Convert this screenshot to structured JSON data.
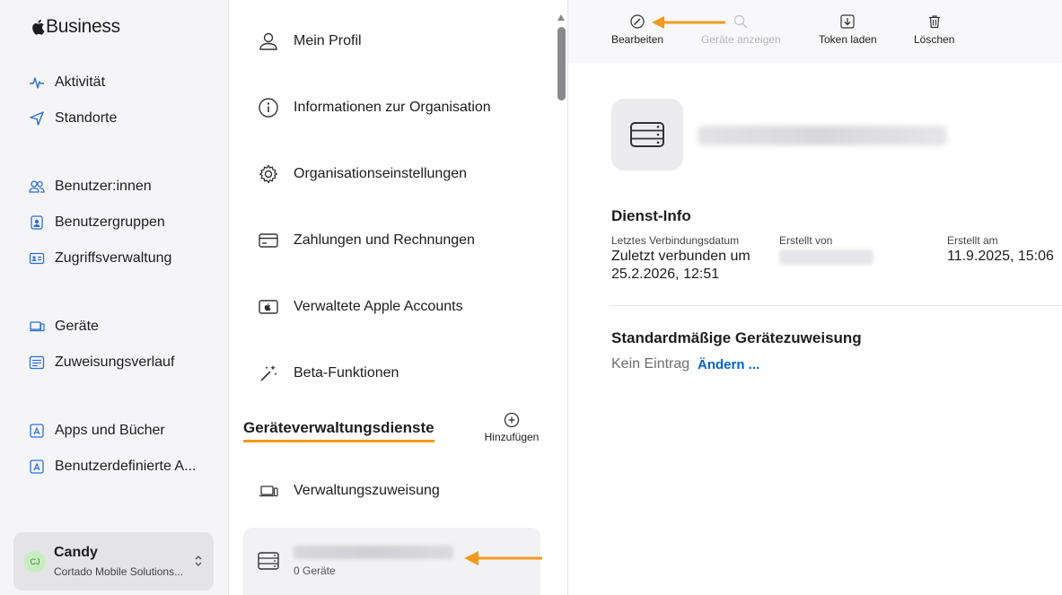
{
  "brand": {
    "name": "Business"
  },
  "sidebar": {
    "items": [
      {
        "label": "Aktivität",
        "icon": "activity-icon"
      },
      {
        "label": "Standorte",
        "icon": "location-arrow-icon"
      },
      {
        "label": "Benutzer:innen",
        "icon": "users-icon"
      },
      {
        "label": "Benutzergruppen",
        "icon": "user-group-badge-icon"
      },
      {
        "label": "Zugriffsverwaltung",
        "icon": "id-card-icon"
      },
      {
        "label": "Geräte",
        "icon": "laptop-icon"
      },
      {
        "label": "Zuweisungsverlauf",
        "icon": "list-history-icon"
      },
      {
        "label": "Apps und Bücher",
        "icon": "app-store-icon"
      },
      {
        "label": "Benutzerdefinierte A...",
        "icon": "app-store-icon"
      }
    ],
    "user": {
      "initials": "CJ",
      "name": "Candy",
      "org": "Cortado Mobile Solutions..."
    }
  },
  "settings": {
    "items": [
      {
        "label": "Mein Profil",
        "icon": "person-icon"
      },
      {
        "label": "Informationen zur Organisation",
        "icon": "info-circle-icon"
      },
      {
        "label": "Organisationseinstellungen",
        "icon": "gear-icon"
      },
      {
        "label": "Zahlungen und Rechnungen",
        "icon": "credit-card-icon"
      },
      {
        "label": "Verwaltete Apple Accounts",
        "icon": "apple-card-icon"
      },
      {
        "label": "Beta-Funktionen",
        "icon": "magic-wand-icon"
      }
    ],
    "section_title": "Geräteverwaltungsdienste",
    "add_label": "Hinzufügen",
    "assignment_label": "Verwaltungszuweisung",
    "service": {
      "count_label": "0 Geräte"
    }
  },
  "toolbar": {
    "edit": "Bearbeiten",
    "show_devices": "Geräte anzeigen",
    "load_token": "Token laden",
    "delete": "Löschen"
  },
  "detail": {
    "service_info_title": "Dienst-Info",
    "last_connection_label": "Letztes Verbindungsdatum",
    "last_connection_value_line1": "Zuletzt verbunden um",
    "last_connection_value_line2": "25.2.2026, 12:51",
    "created_by_label": "Erstellt von",
    "created_at_label": "Erstellt am",
    "created_at_value": "11.9.2025, 15:06",
    "default_assignment_title": "Standardmäßige Gerätezuweisung",
    "no_entry": "Kein Eintrag",
    "change_link": "Ändern ..."
  },
  "colors": {
    "accent_orange": "#f39a1e",
    "link_blue": "#0066cc",
    "sidebar_bg": "#f5f5f7"
  }
}
